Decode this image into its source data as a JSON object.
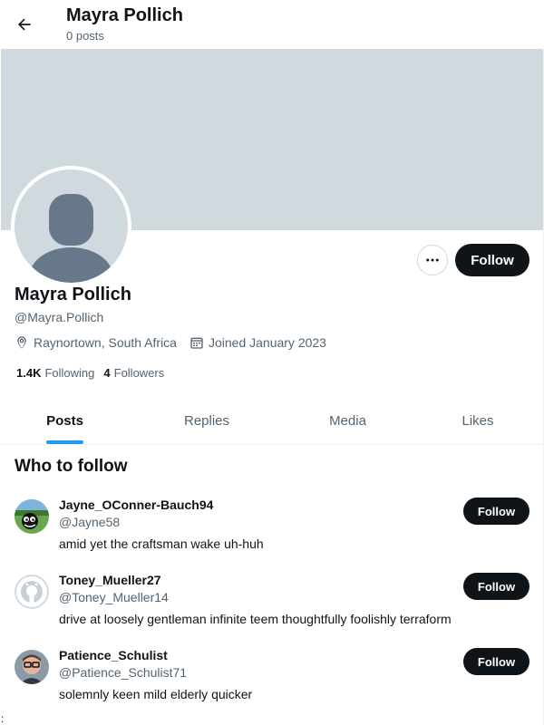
{
  "header": {
    "title": "Mayra Pollich",
    "subtitle": "0 posts"
  },
  "profile": {
    "name": "Mayra Pollich",
    "handle": "@Mayra.Pollich",
    "location": "Raynortown, South Africa",
    "joined": "Joined January 2023",
    "following_count": "1.4K",
    "following_label": "Following",
    "followers_count": "4",
    "followers_label": "Followers",
    "follow_label": "Follow"
  },
  "tabs": [
    {
      "label": "Posts",
      "active": true
    },
    {
      "label": "Replies",
      "active": false
    },
    {
      "label": "Media",
      "active": false
    },
    {
      "label": "Likes",
      "active": false
    }
  ],
  "who_to_follow": {
    "title": "Who to follow",
    "items": [
      {
        "name": "Jayne_OConner-Bauch94",
        "handle": "@Jayne58",
        "bio": "amid yet the craftsman wake uh-huh",
        "follow_label": "Follow"
      },
      {
        "name": "Toney_Mueller27",
        "handle": "@Toney_Mueller14",
        "bio": "drive at loosely gentleman infinite teem thoughtfully foolishly terraform",
        "follow_label": "Follow"
      },
      {
        "name": "Patience_Schulist",
        "handle": "@Patience_Schulist71",
        "bio": "solemnly keen mild elderly quicker",
        "follow_label": "Follow"
      }
    ]
  },
  "stray_char": ":",
  "colors": {
    "banner": "#cfd9de",
    "accent": "#1d9bf0",
    "button": "#0f1419",
    "secondary_text": "#536471"
  },
  "icons": [
    "back-arrow-icon",
    "more-dots-icon",
    "location-icon",
    "calendar-icon",
    "github-icon"
  ]
}
